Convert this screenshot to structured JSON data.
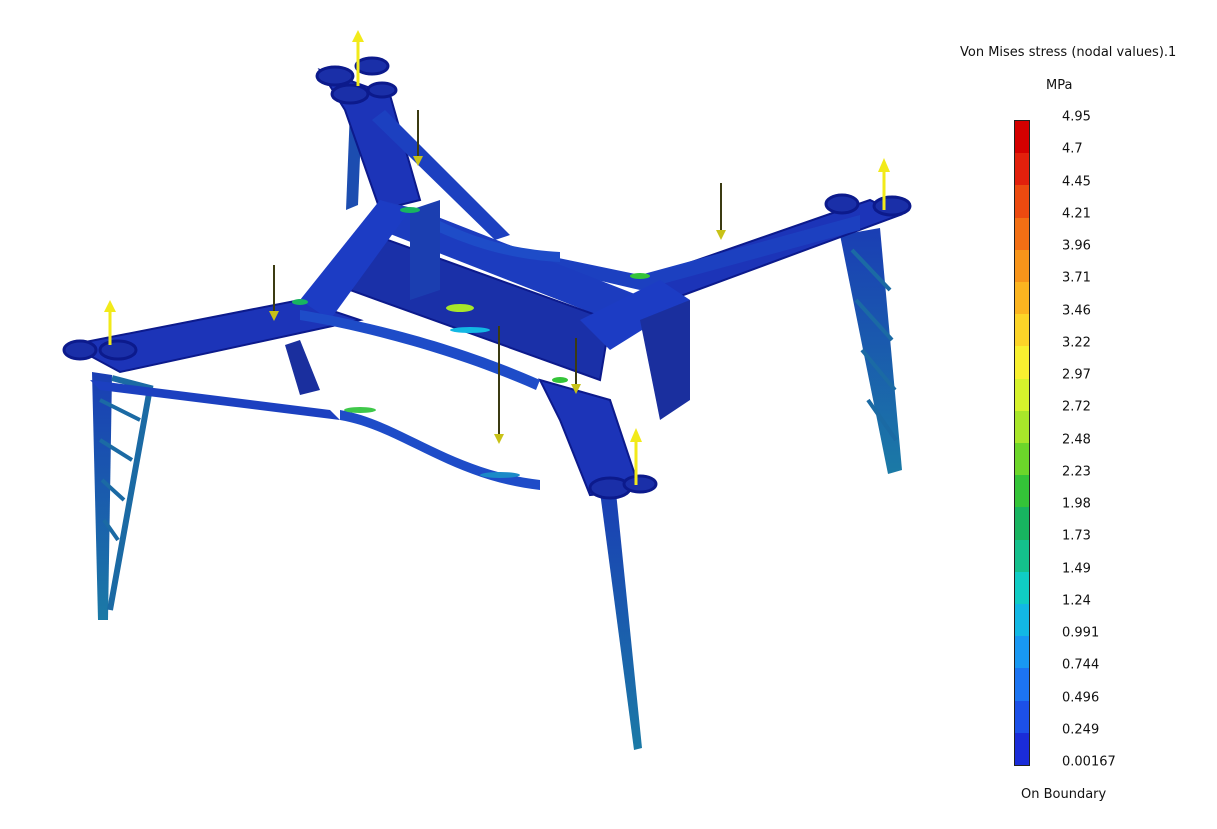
{
  "legend": {
    "title": "Von Mises stress (nodal values).1",
    "unit": "MPa",
    "footer": "On Boundary",
    "ticks": [
      "4.95",
      "4.7",
      "4.45",
      "4.21",
      "3.96",
      "3.71",
      "3.46",
      "3.22",
      "2.97",
      "2.72",
      "2.48",
      "2.23",
      "1.98",
      "1.73",
      "1.49",
      "1.24",
      "0.991",
      "0.744",
      "0.496",
      "0.249",
      "0.00167"
    ],
    "band_colors": [
      "#d40000",
      "#e2200c",
      "#ec4a10",
      "#f26f14",
      "#f7941a",
      "#fbb420",
      "#fcd428",
      "#f8f030",
      "#d6f22c",
      "#a8e62a",
      "#6cd62a",
      "#34c438",
      "#18b460",
      "#14c08c",
      "#10ccc4",
      "#12b8e4",
      "#1898f2",
      "#1c74f2",
      "#1c50e8",
      "#1a2cd8"
    ]
  },
  "model": {
    "frame_color": "#1c34b8",
    "frame_dark": "#0c1a8c",
    "leg_color": "#1a6aa0",
    "hotspot_color": "#3fc84a",
    "load_arrow_color": "#f2ea1a"
  }
}
